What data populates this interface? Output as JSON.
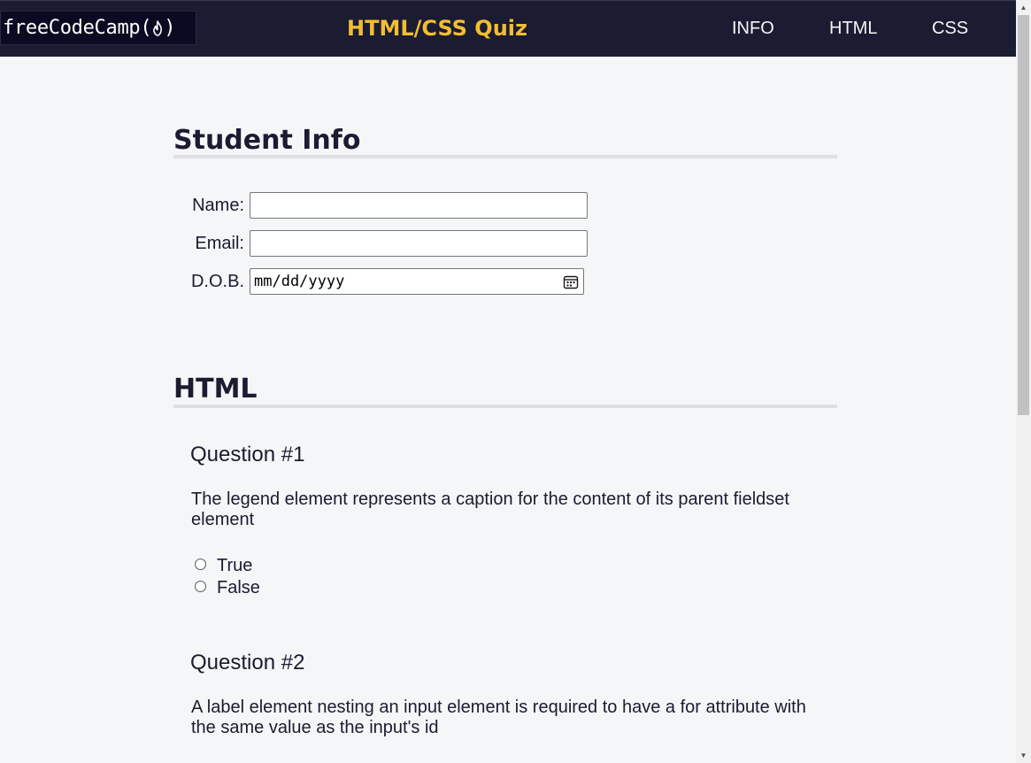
{
  "header": {
    "logo_text": "freeCodeCamp(",
    "logo_suffix": ")",
    "title": "HTML/CSS Quiz",
    "nav": [
      "INFO",
      "HTML",
      "CSS"
    ]
  },
  "student_info": {
    "heading": "Student Info",
    "name_label": "Name:",
    "name_value": "",
    "email_label": "Email:",
    "email_value": "",
    "dob_label": "D.O.B.",
    "dob_placeholder": "mm/dd/yyyy"
  },
  "html_section": {
    "heading": "HTML",
    "questions": [
      {
        "title": "Question #1",
        "text": "The legend element represents a caption for the content of its parent fieldset element",
        "options": [
          "True",
          "False"
        ]
      },
      {
        "title": "Question #2",
        "text": "A label element nesting an input element is required to have a for attribute with the same value as the input's id"
      }
    ]
  },
  "icons": {
    "logo": "freecodecamp-flame-icon",
    "date_picker": "calendar-icon"
  },
  "colors": {
    "header_bg": "#1b1b32",
    "title_accent": "#f1be32",
    "page_bg": "#f5f6f7"
  }
}
